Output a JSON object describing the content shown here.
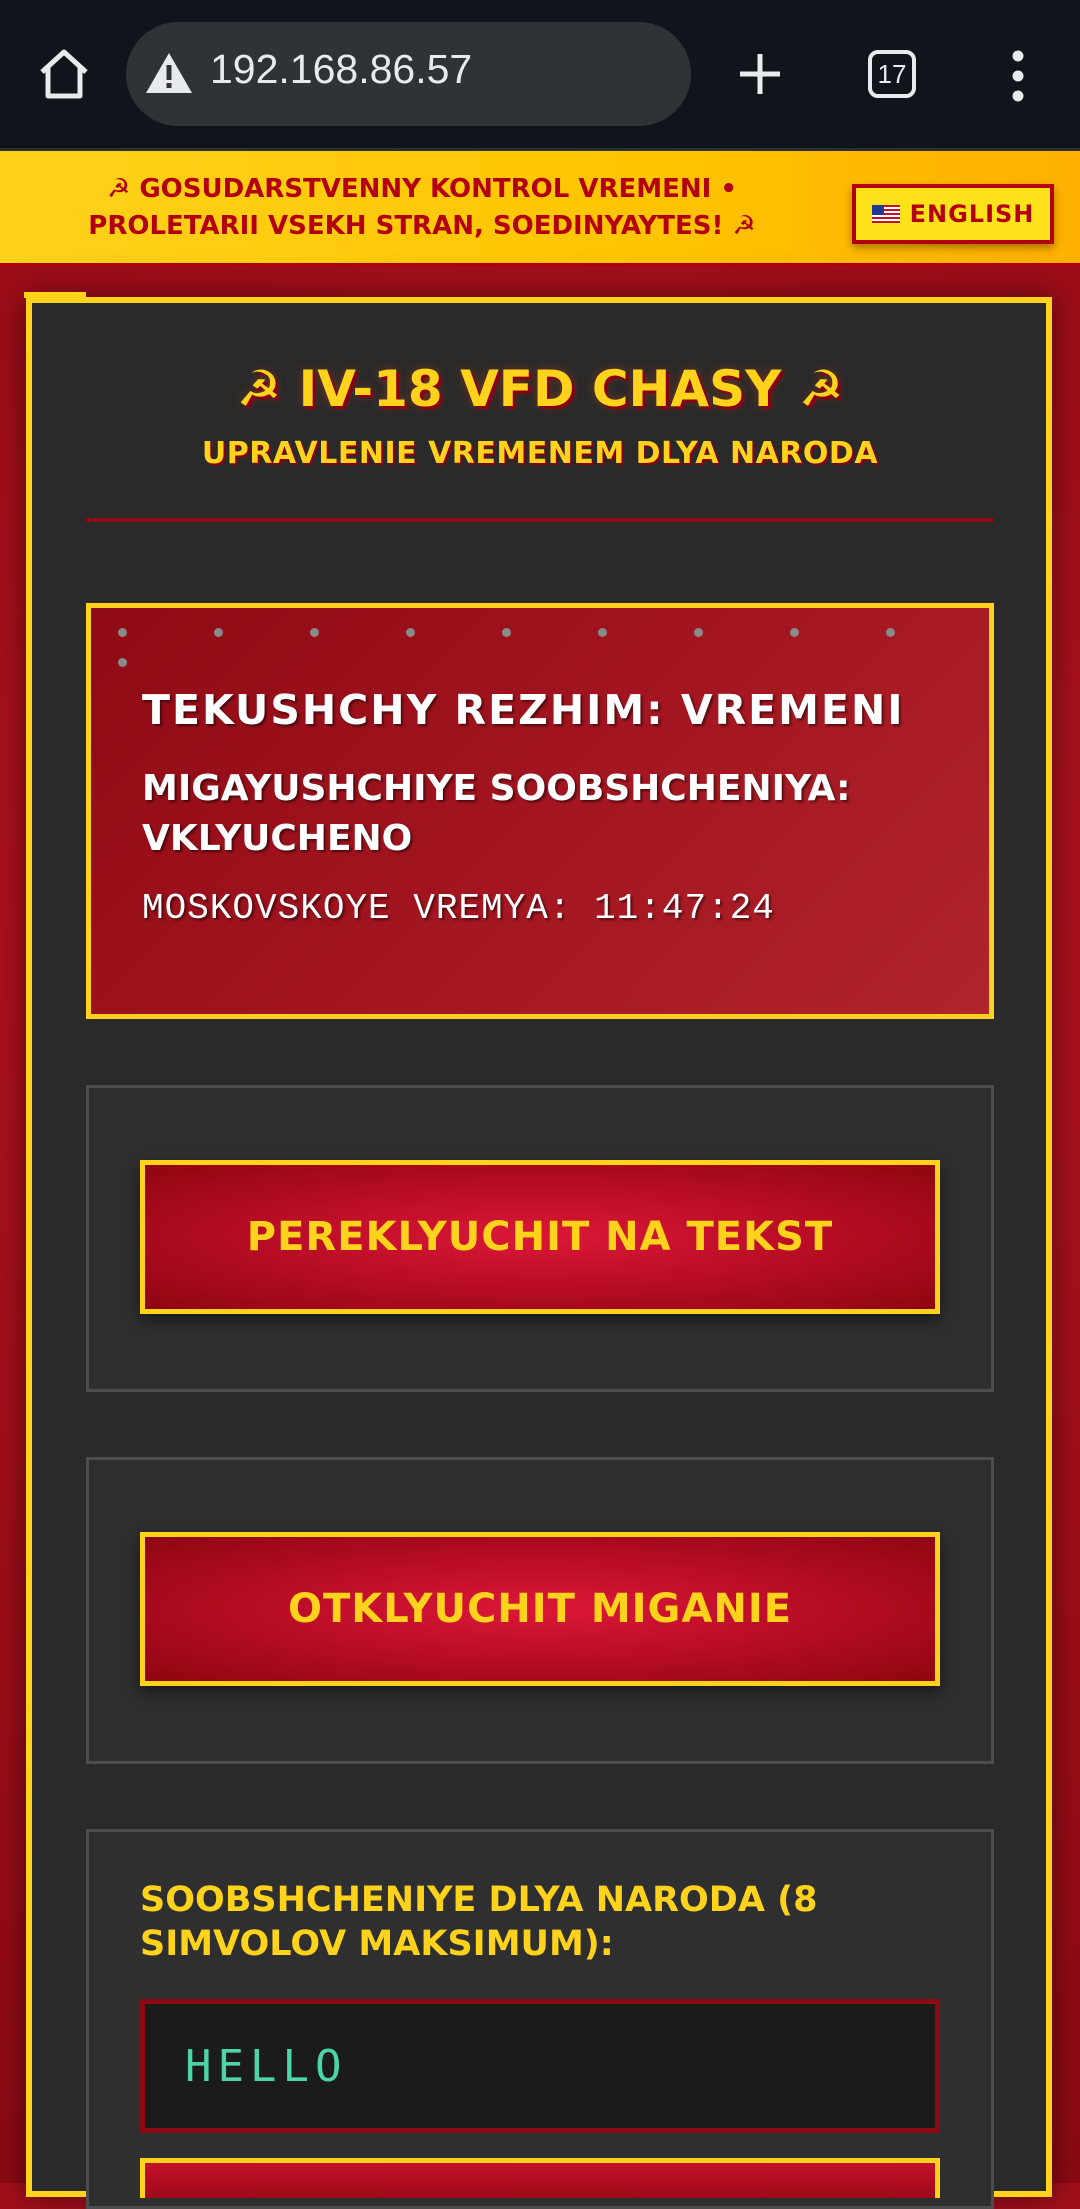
{
  "browser": {
    "url": "192.168.86.57",
    "tab_count": "17",
    "icons": [
      "home-icon",
      "warning-icon",
      "plus-icon",
      "tabs-icon",
      "menu-icon"
    ]
  },
  "banner": {
    "text": "☭ GOSUDARSTVENNY KONTROL VREMENI • PROLETARII VSEKH STRAN, SOEDINYAYTES! ☭",
    "language_button": "ENGLISH"
  },
  "header": {
    "title": "☭ IV-18 VFD CHASY ☭",
    "subtitle": "UPRAVLENIE VREMENEM DLYA NARODA"
  },
  "status": {
    "mode": "TEKUSHCHY REZHIM: VREMENI",
    "blinking": "MIGAYUSHCHIYE SOOBSHCHENIYA: VKLYUCHENO",
    "time": "MOSKOVSKOYE VREMYA: 11:47:24"
  },
  "controls": {
    "switch_text_button": "PEREKLYUCHIT NA TEKST",
    "disable_blink_button": "OTKLYUCHIT MIGANIE",
    "message_label": "SOOBSHCHENIYE DLYA NARODA (8 SIMVOLOV MAKSIMUM):",
    "message_value": "HELLO"
  },
  "colors": {
    "gold": "#ffd21c",
    "red": "#b3000f",
    "panel": "#2a2a2a",
    "input_text": "#4fd4a8"
  }
}
